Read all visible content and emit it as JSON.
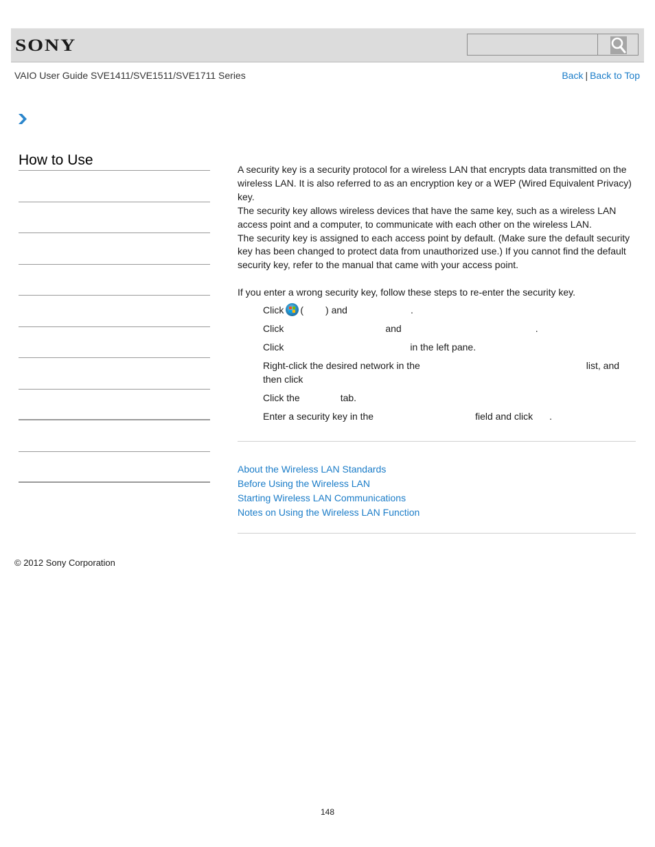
{
  "header": {
    "logo": "SONY",
    "search": {
      "placeholder": "",
      "value": "",
      "button_icon": "magnifier-icon"
    }
  },
  "guide_title": "VAIO User Guide SVE1411/SVE1511/SVE1711 Series",
  "nav_links": {
    "back": "Back",
    "separator": "|",
    "back_to_top": "Back to Top"
  },
  "breadcrumb": {
    "icon": "chevron-right-icon"
  },
  "sidebar": {
    "title": "How to Use",
    "item_count": 10
  },
  "main": {
    "intro": [
      "A security key is a security protocol for a wireless LAN that encrypts data transmitted on the wireless LAN. It is also referred to as an encryption key or a WEP (Wired Equivalent Privacy) key.",
      "The security key allows wireless devices that have the same key, such as a wireless LAN access point and a computer, to communicate with each other on the wireless LAN.",
      "The security key is assigned to each access point by default. (Make sure the default security key has been changed to protect data from unauthorized use.) If you cannot find the default security key, refer to the manual that came with your access point."
    ],
    "steps_intro": "If you enter a wrong security key, follow these steps to re-enter the security key.",
    "steps": [
      {
        "a": "Click",
        "b": "(",
        "c": ") and",
        "d": "."
      },
      {
        "a": "Click",
        "b": "and",
        "c": "."
      },
      {
        "a": "Click",
        "b": "in the left pane."
      },
      {
        "a": "Right-click the desired network in the",
        "b": "list, and then click",
        "c": "."
      },
      {
        "a": "Click the",
        "b": "tab."
      },
      {
        "a": "Enter a security key in the",
        "b": "field and click",
        "c": "."
      }
    ],
    "start_icon": "windows-start-orb-icon"
  },
  "related_links": [
    "About the Wireless LAN Standards",
    "Before Using the Wireless LAN",
    "Starting Wireless LAN Communications",
    "Notes on Using the Wireless LAN Function"
  ],
  "footer": {
    "copyright": "© 2012 Sony Corporation",
    "page_number": "148"
  },
  "colors": {
    "link": "#1a7cc8",
    "header_bg": "#dcdcdc",
    "rule": "#999999"
  }
}
